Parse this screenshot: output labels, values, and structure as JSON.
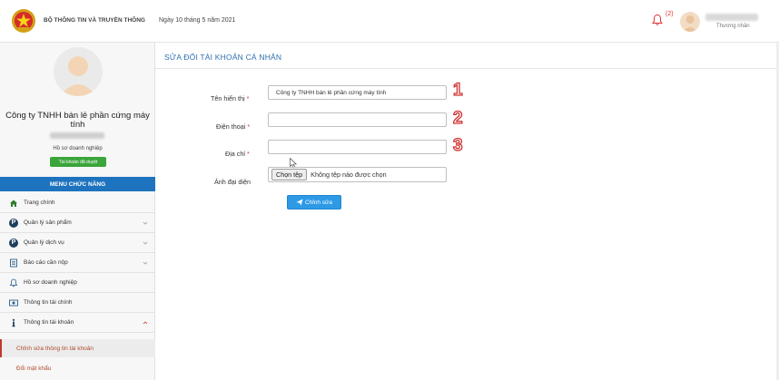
{
  "header": {
    "ministry": "BỘ THÔNG TIN VÀ TRUYỀN THÔNG",
    "date": "Ngày 10 tháng 5 năm 2021",
    "notification_count": "(2)",
    "user_role": "Thương nhân"
  },
  "sidebar": {
    "company_name": "Công ty TNHH bán lẻ phần cứng máy tính",
    "profile_label": "Hồ sơ doanh nghiệp",
    "status_badge": "Tài khoản đã duyệt",
    "menu_title": "MENU CHỨC NĂNG",
    "items": [
      {
        "label": "Trang chính",
        "icon": "home-icon"
      },
      {
        "label": "Quản lý sản phẩm",
        "icon": "p-circle-icon"
      },
      {
        "label": "Quản lý dịch vụ",
        "icon": "p-circle-icon"
      },
      {
        "label": "Báo cáo cần nộp",
        "icon": "document-icon"
      },
      {
        "label": "Hồ sơ doanh nghiệp",
        "icon": "bell-icon"
      },
      {
        "label": "Thông tin tài chính",
        "icon": "money-icon"
      },
      {
        "label": "Thông tin tài khoản",
        "icon": "info-icon"
      }
    ],
    "subitems": [
      {
        "label": "Chỉnh sửa thông tin tài khoản"
      },
      {
        "label": "Đổi mật khẩu"
      }
    ]
  },
  "form": {
    "title": "SỬA ĐỔI TÀI KHOẢN CÁ NHÂN",
    "display_name_label": "Tên hiển thị",
    "display_name_value": "Công ty TNHH bán lẻ phần cứng máy tính",
    "phone_label": "Điện thoại",
    "phone_value": "",
    "address_label": "Địa chỉ",
    "address_value": "",
    "avatar_label": "Ảnh đại diện",
    "file_button": "Chọn tệp",
    "file_status": "Không tệp nào được chọn",
    "required_mark": "*",
    "submit_label": "Chỉnh sửa"
  },
  "annotations": [
    "1",
    "2",
    "3"
  ],
  "colors": {
    "primary": "#1e73be",
    "title": "#2c6fb0",
    "button": "#2e9ae6",
    "badge": "#3aa53a",
    "annotation": "#d23232"
  }
}
